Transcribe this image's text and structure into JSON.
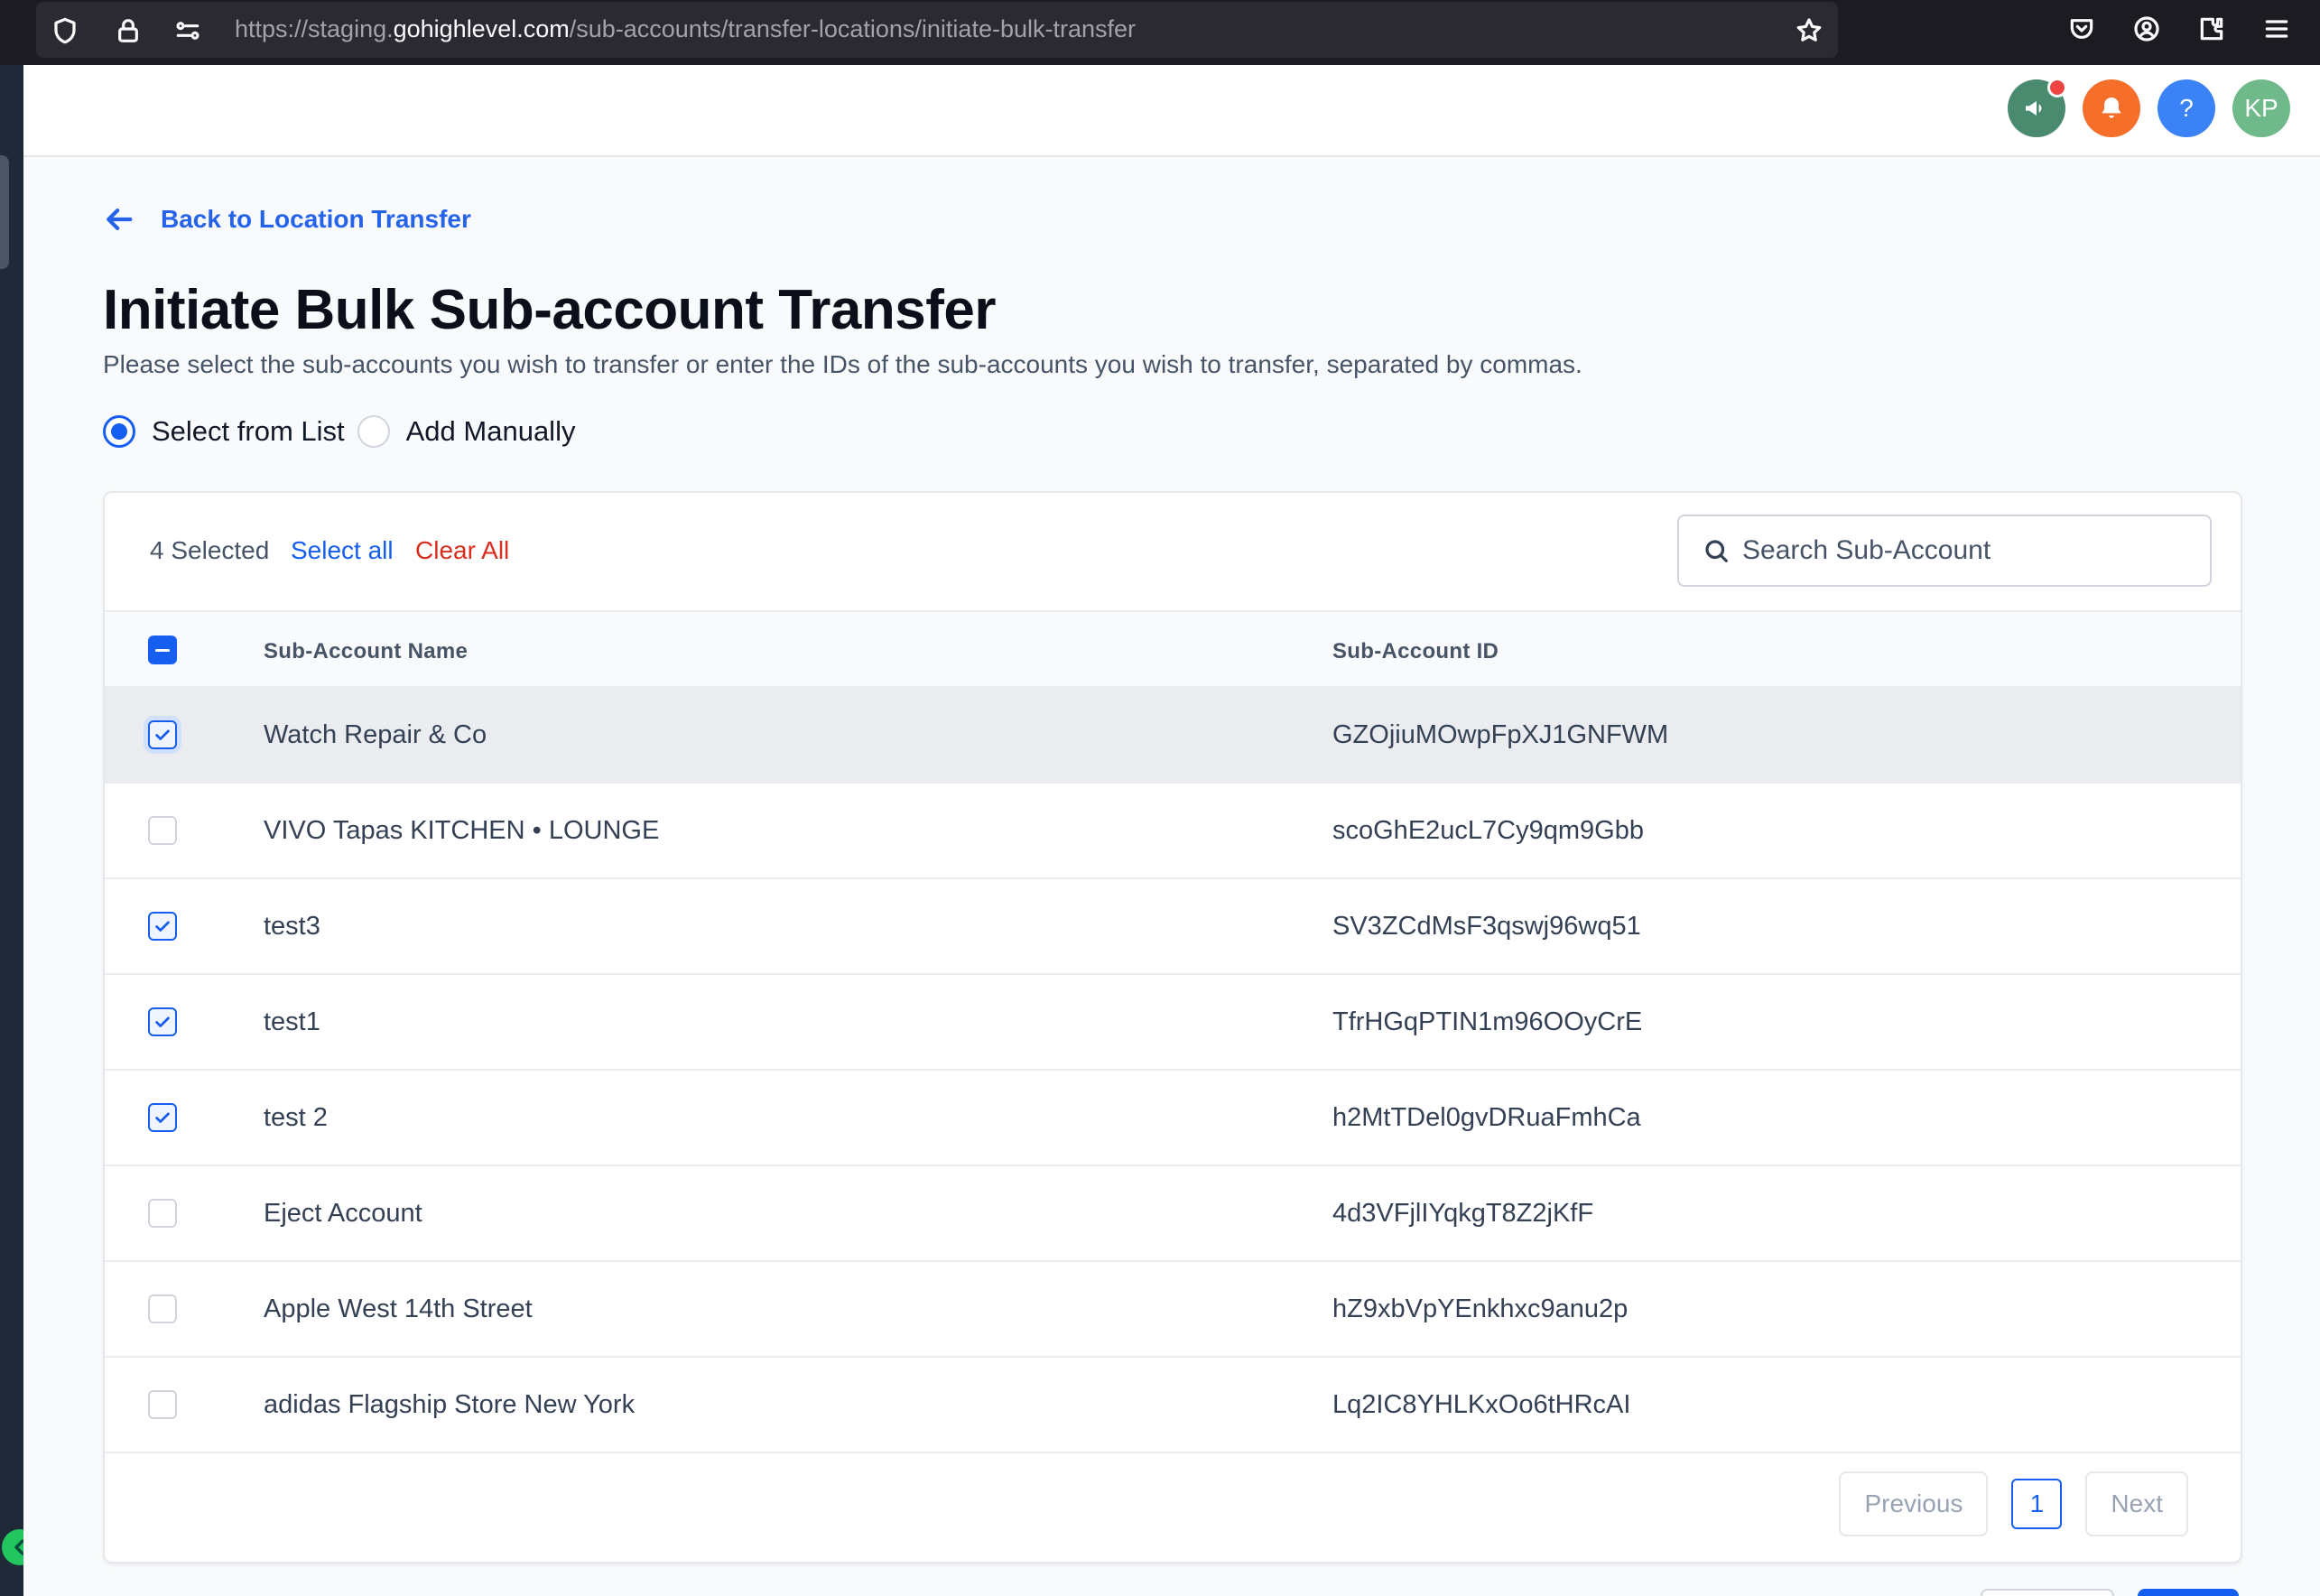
{
  "browser": {
    "url_prefix": "https://staging.",
    "url_host": "gohighlevel.com",
    "url_path": "/sub-accounts/transfer-locations/initiate-bulk-transfer"
  },
  "header": {
    "avatar_initials": "KP",
    "help_label": "?",
    "colors": {
      "announce": "#4a8a6f",
      "bell": "#f56f2a",
      "help": "#3b82f6",
      "avatar": "#6fb98a"
    }
  },
  "page": {
    "back_label": "Back to Location Transfer",
    "title": "Initiate Bulk Sub-account Transfer",
    "subtitle": "Please select the sub-accounts you wish to transfer or enter the IDs of the sub-accounts you wish to transfer, separated by commas."
  },
  "mode": {
    "options": [
      {
        "label": "Select from List",
        "selected": true
      },
      {
        "label": "Add Manually",
        "selected": false
      }
    ]
  },
  "toolbar": {
    "selected_count": "4 Selected",
    "select_all_label": "Select all",
    "clear_all_label": "Clear All",
    "search_placeholder": "Search Sub-Account"
  },
  "table": {
    "columns": [
      "Sub-Account Name",
      "Sub-Account ID"
    ],
    "header_checkbox_state": "indeterminate",
    "rows": [
      {
        "name": "Watch Repair & Co",
        "id": "GZOjiuMOwpFpXJ1GNFWM",
        "checked": true
      },
      {
        "name": "VIVO Tapas KITCHEN • LOUNGE",
        "id": "scoGhE2ucL7Cy9qm9Gbb",
        "checked": false
      },
      {
        "name": "test3",
        "id": "SV3ZCdMsF3qswj96wq51",
        "checked": true
      },
      {
        "name": "test1",
        "id": "TfrHGqPTIN1m96OOyCrE",
        "checked": true
      },
      {
        "name": "test 2",
        "id": "h2MtTDel0gvDRuaFmhCa",
        "checked": true
      },
      {
        "name": "Eject Account",
        "id": "4d3VFjlIYqkgT8Z2jKfF",
        "checked": false
      },
      {
        "name": "Apple West 14th Street",
        "id": "hZ9xbVpYEnkhxc9anu2p",
        "checked": false
      },
      {
        "name": "adidas Flagship Store New York",
        "id": "Lq2IC8YHLKxOo6tHRcAI",
        "checked": false
      }
    ]
  },
  "pagination": {
    "previous_label": "Previous",
    "current_page": "1",
    "next_label": "Next"
  }
}
